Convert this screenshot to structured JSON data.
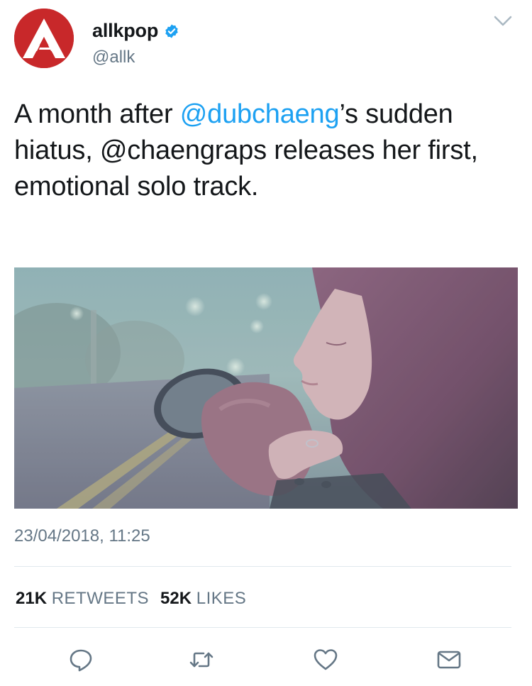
{
  "account": {
    "display_name": "allkpop",
    "handle": "@allk",
    "verified": true,
    "avatar_letter": "A",
    "brand_color": "#c8282a"
  },
  "tweet": {
    "text_parts": [
      {
        "text": "A month after ",
        "type": "text"
      },
      {
        "text": "@dubchaeng",
        "type": "mention"
      },
      {
        "text": "’s sudden hiatus, @chaengraps releases her first, emotional solo track.",
        "type": "text"
      }
    ],
    "timestamp": "23/04/2018, 11:25"
  },
  "stats": {
    "retweets_count": "21K",
    "retweets_label": "RETWEETS",
    "likes_count": "52K",
    "likes_label": "LIKES"
  },
  "actions": [
    {
      "name": "reply-icon"
    },
    {
      "name": "retweet-icon"
    },
    {
      "name": "like-icon"
    },
    {
      "name": "direct-message-icon"
    }
  ],
  "colors": {
    "text": "#14171a",
    "secondary": "#657786",
    "link": "#1da1f2",
    "divider": "#e1e8ed"
  }
}
